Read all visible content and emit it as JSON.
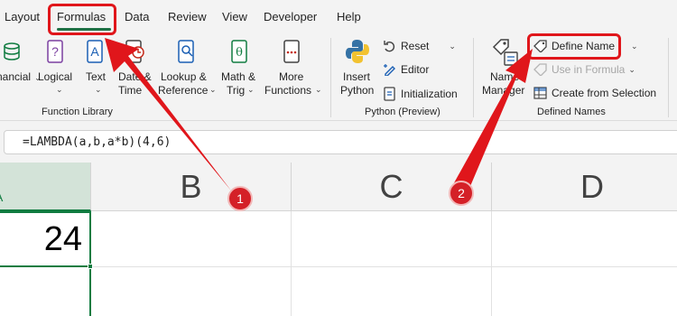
{
  "tabs": [
    {
      "label": "Layout"
    },
    {
      "label": "Formulas"
    },
    {
      "label": "Data"
    },
    {
      "label": "Review"
    },
    {
      "label": "View"
    },
    {
      "label": "Developer"
    },
    {
      "label": "Help"
    }
  ],
  "ribbon": {
    "function_library": {
      "buttons": [
        {
          "line1": "nancial",
          "line2": ""
        },
        {
          "line1": "Logical",
          "line2": ""
        },
        {
          "line1": "Text",
          "line2": ""
        },
        {
          "line1": "Date &",
          "line2": "Time"
        },
        {
          "line1": "Lookup &",
          "line2": "Reference"
        },
        {
          "line1": "Math &",
          "line2": "Trig"
        },
        {
          "line1": "More",
          "line2": "Functions"
        }
      ],
      "group_label": "Function Library"
    },
    "python": {
      "insert_line1": "Insert",
      "insert_line2": "Python",
      "reset": "Reset",
      "editor": "Editor",
      "initialization": "Initialization",
      "group_label": "Python (Preview)"
    },
    "defined_names": {
      "manager_line1": "Name",
      "manager_line2": "Manager",
      "define_name": "Define Name",
      "use_in_formula": "Use in Formula",
      "create_from_selection": "Create from Selection",
      "group_label": "Defined Names"
    }
  },
  "formula_bar": {
    "formula": "=LAMBDA(a,b,a*b)(4,6)"
  },
  "grid": {
    "columns": [
      "A",
      "B",
      "C",
      "D"
    ],
    "active_value": "24"
  },
  "annotations": {
    "badge1": "1",
    "badge2": "2",
    "color": "#e0161b"
  }
}
